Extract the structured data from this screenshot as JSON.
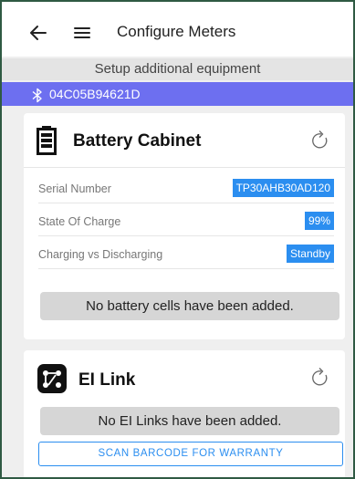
{
  "appbar": {
    "title": "Configure Meters",
    "back_icon": "arrow-left-icon",
    "menu_icon": "hamburger-menu-icon"
  },
  "subheader": "Setup additional equipment",
  "device": {
    "icon": "bluetooth-icon",
    "id": "04C05B94621D"
  },
  "battery_card": {
    "icon": "battery-icon",
    "title": "Battery Cabinet",
    "refresh_icon": "refresh-icon",
    "rows": [
      {
        "label": "Serial Number",
        "value": "TP30AHB30AD120"
      },
      {
        "label": "State Of Charge",
        "value": "99%"
      },
      {
        "label": "Charging vs Discharging",
        "value": "Standby"
      }
    ],
    "empty_text": "No battery cells have been added."
  },
  "ei_card": {
    "icon": "ei-link-icon",
    "title": "EI Link",
    "refresh_icon": "refresh-icon",
    "empty_text": "No EI Links have been added.",
    "scan_button": "SCAN BARCODE FOR WARRANTY"
  },
  "colors": {
    "device_bar": "#6d6ff0",
    "value_badge": "#2b8ef0",
    "frame_border": "#2f5a43"
  }
}
